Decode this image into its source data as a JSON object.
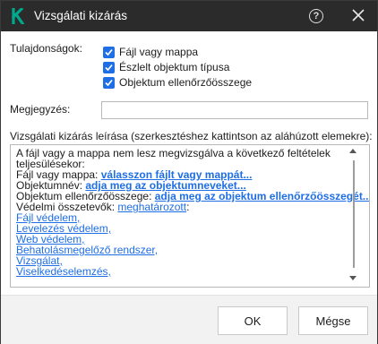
{
  "window": {
    "title": "Vizsgálati kizárás"
  },
  "properties": {
    "label": "Tulajdonságok:",
    "items": [
      {
        "label": "Fájl vagy mappa",
        "checked": true
      },
      {
        "label": "Észlelt objektum típusa",
        "checked": true
      },
      {
        "label": "Objektum ellenőrzőösszege",
        "checked": true
      }
    ]
  },
  "comment": {
    "label": "Megjegyzés:",
    "value": ""
  },
  "description": {
    "label": "Vizsgálati kizárás leírása (szerkesztéshez kattintson az aláhúzott elemekre):",
    "intro_line1": "A fájl vagy a mappa nem lesz megvizsgálva a következő feltételek",
    "intro_line2": "teljesülésekor:",
    "file_label": "Fájl vagy mappa: ",
    "file_link": "válasszon fájlt vagy mappát...",
    "object_label": "Objektumnév: ",
    "object_link": "adja meg az objektumneveket...",
    "checksum_label": "Objektum ellenőrzőösszege: ",
    "checksum_link": "adja meg az objektum ellenőrzőösszegét...",
    "components_label": "Védelmi összetevők: ",
    "components_link": "meghatározott",
    "components_suffix": ":",
    "components": [
      "Fájl védelem,",
      "Levelezés védelem,",
      "Web védelem,",
      "Behatolásmegelőző rendszer,",
      "Vizsgálat,",
      "Viselkedéselemzés,"
    ]
  },
  "buttons": {
    "ok": "OK",
    "cancel": "Mégse"
  },
  "colors": {
    "titlebar": "#2b2b2b",
    "accent": "#1e6ee6",
    "brand": "#00a88e"
  }
}
